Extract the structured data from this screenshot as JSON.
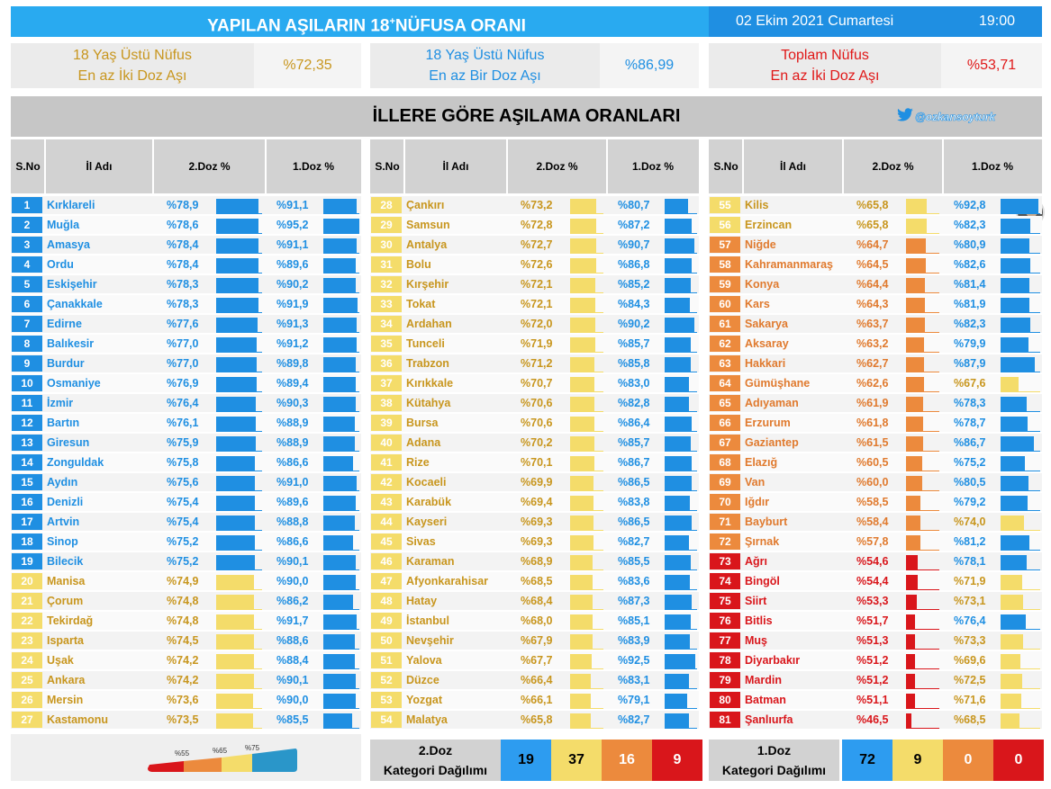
{
  "header": {
    "title_main": "YAPILAN AŞILARIN 18",
    "title_sup": "+",
    "title_end": "NÜFUSA ORANI",
    "date": "02 Ekim 2021 Cumartesi",
    "time": "19:00"
  },
  "summary": [
    {
      "line1": "18 Yaş Üstü Nüfus",
      "line2": "En az İki Doz Aşı",
      "value": "%72,35",
      "color": "#c8961e"
    },
    {
      "line1": "18 Yaş Üstü Nüfus",
      "line2": "En az Bir Doz Aşı",
      "value": "%86,99",
      "color": "#1f8fe2"
    },
    {
      "line1": "Toplam Nüfus",
      "line2": "En az İki Doz Aşı",
      "value": "%53,71",
      "color": "#e01818"
    }
  ],
  "section": {
    "title": "İLLERE GÖRE AŞILAMA ORANLARI",
    "handle": "@ozkansoyturk",
    "handle_icon": "twitter-bird-icon"
  },
  "table_headers": {
    "no": "S.No",
    "name": "İl Adı",
    "dose2": "2.Doz %",
    "dose1": "1.Doz %"
  },
  "colors": {
    "blue": "#1f8fe2",
    "yellow": "#f4dc6a",
    "orange": "#ec8a3d",
    "red": "#d9161b",
    "text_blue": "#1f8fe2",
    "text_yellow": "#c8961e",
    "text_orange": "#e07a2e",
    "text_red": "#d9161b"
  },
  "chart_data": {
    "type": "table",
    "columns": [
      "S.No",
      "İl Adı",
      "2.Doz %",
      "1.Doz %"
    ],
    "rows": [
      [
        "1",
        "Kırklareli",
        "%78,9",
        "%91,1"
      ],
      [
        "2",
        "Muğla",
        "%78,6",
        "%95,2"
      ],
      [
        "3",
        "Amasya",
        "%78,4",
        "%91,1"
      ],
      [
        "4",
        "Ordu",
        "%78,4",
        "%89,6"
      ],
      [
        "5",
        "Eskişehir",
        "%78,3",
        "%90,2"
      ],
      [
        "6",
        "Çanakkale",
        "%78,3",
        "%91,9"
      ],
      [
        "7",
        "Edirne",
        "%77,6",
        "%91,3"
      ],
      [
        "8",
        "Balıkesir",
        "%77,0",
        "%91,2"
      ],
      [
        "9",
        "Burdur",
        "%77,0",
        "%89,8"
      ],
      [
        "10",
        "Osmaniye",
        "%76,9",
        "%89,4"
      ],
      [
        "11",
        "İzmir",
        "%76,4",
        "%90,3"
      ],
      [
        "12",
        "Bartın",
        "%76,1",
        "%88,9"
      ],
      [
        "13",
        "Giresun",
        "%75,9",
        "%88,9"
      ],
      [
        "14",
        "Zonguldak",
        "%75,8",
        "%86,6"
      ],
      [
        "15",
        "Aydın",
        "%75,6",
        "%91,0"
      ],
      [
        "16",
        "Denizli",
        "%75,4",
        "%89,6"
      ],
      [
        "17",
        "Artvin",
        "%75,4",
        "%88,8"
      ],
      [
        "18",
        "Sinop",
        "%75,2",
        "%86,6"
      ],
      [
        "19",
        "Bilecik",
        "%75,2",
        "%90,1"
      ],
      [
        "20",
        "Manisa",
        "%74,9",
        "%90,0"
      ],
      [
        "21",
        "Çorum",
        "%74,8",
        "%86,2"
      ],
      [
        "22",
        "Tekirdağ",
        "%74,8",
        "%91,7"
      ],
      [
        "23",
        "Isparta",
        "%74,5",
        "%88,6"
      ],
      [
        "24",
        "Uşak",
        "%74,2",
        "%88,4"
      ],
      [
        "25",
        "Ankara",
        "%74,2",
        "%90,1"
      ],
      [
        "26",
        "Mersin",
        "%73,6",
        "%90,0"
      ],
      [
        "27",
        "Kastamonu",
        "%73,5",
        "%85,5"
      ],
      [
        "28",
        "Çankırı",
        "%73,2",
        "%80,7"
      ],
      [
        "29",
        "Samsun",
        "%72,8",
        "%87,2"
      ],
      [
        "30",
        "Antalya",
        "%72,7",
        "%90,7"
      ],
      [
        "31",
        "Bolu",
        "%72,6",
        "%86,8"
      ],
      [
        "32",
        "Kırşehir",
        "%72,1",
        "%85,2"
      ],
      [
        "33",
        "Tokat",
        "%72,1",
        "%84,3"
      ],
      [
        "34",
        "Ardahan",
        "%72,0",
        "%90,2"
      ],
      [
        "35",
        "Tunceli",
        "%71,9",
        "%85,7"
      ],
      [
        "36",
        "Trabzon",
        "%71,2",
        "%85,8"
      ],
      [
        "37",
        "Kırıkkale",
        "%70,7",
        "%83,0"
      ],
      [
        "38",
        "Kütahya",
        "%70,6",
        "%82,8"
      ],
      [
        "39",
        "Bursa",
        "%70,6",
        "%86,4"
      ],
      [
        "40",
        "Adana",
        "%70,2",
        "%85,7"
      ],
      [
        "41",
        "Rize",
        "%70,1",
        "%86,7"
      ],
      [
        "42",
        "Kocaeli",
        "%69,9",
        "%86,5"
      ],
      [
        "43",
        "Karabük",
        "%69,4",
        "%83,8"
      ],
      [
        "44",
        "Kayseri",
        "%69,3",
        "%86,5"
      ],
      [
        "45",
        "Sivas",
        "%69,3",
        "%82,7"
      ],
      [
        "46",
        "Karaman",
        "%68,9",
        "%85,5"
      ],
      [
        "47",
        "Afyonkarahisar",
        "%68,5",
        "%83,6"
      ],
      [
        "48",
        "Hatay",
        "%68,4",
        "%87,3"
      ],
      [
        "49",
        "İstanbul",
        "%68,0",
        "%85,1"
      ],
      [
        "50",
        "Nevşehir",
        "%67,9",
        "%83,9"
      ],
      [
        "51",
        "Yalova",
        "%67,7",
        "%92,5"
      ],
      [
        "52",
        "Düzce",
        "%66,4",
        "%83,1"
      ],
      [
        "53",
        "Yozgat",
        "%66,1",
        "%79,1"
      ],
      [
        "54",
        "Malatya",
        "%65,8",
        "%82,7"
      ],
      [
        "55",
        "Kilis",
        "%65,8",
        "%92,8"
      ],
      [
        "56",
        "Erzincan",
        "%65,8",
        "%82,3"
      ],
      [
        "57",
        "Niğde",
        "%64,7",
        "%80,9"
      ],
      [
        "58",
        "Kahramanmaraş",
        "%64,5",
        "%82,6"
      ],
      [
        "59",
        "Konya",
        "%64,4",
        "%81,4"
      ],
      [
        "60",
        "Kars",
        "%64,3",
        "%81,9"
      ],
      [
        "61",
        "Sakarya",
        "%63,7",
        "%82,3"
      ],
      [
        "62",
        "Aksaray",
        "%63,2",
        "%79,9"
      ],
      [
        "63",
        "Hakkari",
        "%62,7",
        "%87,9"
      ],
      [
        "64",
        "Gümüşhane",
        "%62,6",
        "%67,6"
      ],
      [
        "65",
        "Adıyaman",
        "%61,9",
        "%78,3"
      ],
      [
        "66",
        "Erzurum",
        "%61,8",
        "%78,7"
      ],
      [
        "67",
        "Gaziantep",
        "%61,5",
        "%86,7"
      ],
      [
        "68",
        "Elazığ",
        "%60,5",
        "%75,2"
      ],
      [
        "69",
        "Van",
        "%60,0",
        "%80,5"
      ],
      [
        "70",
        "Iğdır",
        "%58,5",
        "%79,2"
      ],
      [
        "71",
        "Bayburt",
        "%58,4",
        "%74,0"
      ],
      [
        "72",
        "Şırnak",
        "%57,8",
        "%81,2"
      ],
      [
        "73",
        "Ağrı",
        "%54,6",
        "%78,1"
      ],
      [
        "74",
        "Bingöl",
        "%54,4",
        "%71,9"
      ],
      [
        "75",
        "Siirt",
        "%53,3",
        "%73,1"
      ],
      [
        "76",
        "Bitlis",
        "%51,7",
        "%76,4"
      ],
      [
        "77",
        "Muş",
        "%51,3",
        "%73,3"
      ],
      [
        "78",
        "Diyarbakır",
        "%51,2",
        "%69,6"
      ],
      [
        "79",
        "Mardin",
        "%51,2",
        "%72,5"
      ],
      [
        "80",
        "Batman",
        "%51,1",
        "%71,6"
      ],
      [
        "81",
        "Şanlıurfa",
        "%46,5",
        "%68,5"
      ]
    ],
    "thresholds": [
      55,
      65,
      75
    ],
    "categories": [
      "<%55",
      "%55-65",
      "%65-75",
      ">%75"
    ]
  },
  "legend": {
    "t55": "%55",
    "t65": "%65",
    "t75": "%75"
  },
  "dist2": {
    "line1": "2.Doz",
    "line2": "Kategori Dağılımı",
    "values": [
      "19",
      "37",
      "16",
      "9"
    ]
  },
  "dist1": {
    "line1": "1.Doz",
    "line2": "Kategori Dağılımı",
    "values": [
      "72",
      "9",
      "0",
      "0"
    ]
  }
}
